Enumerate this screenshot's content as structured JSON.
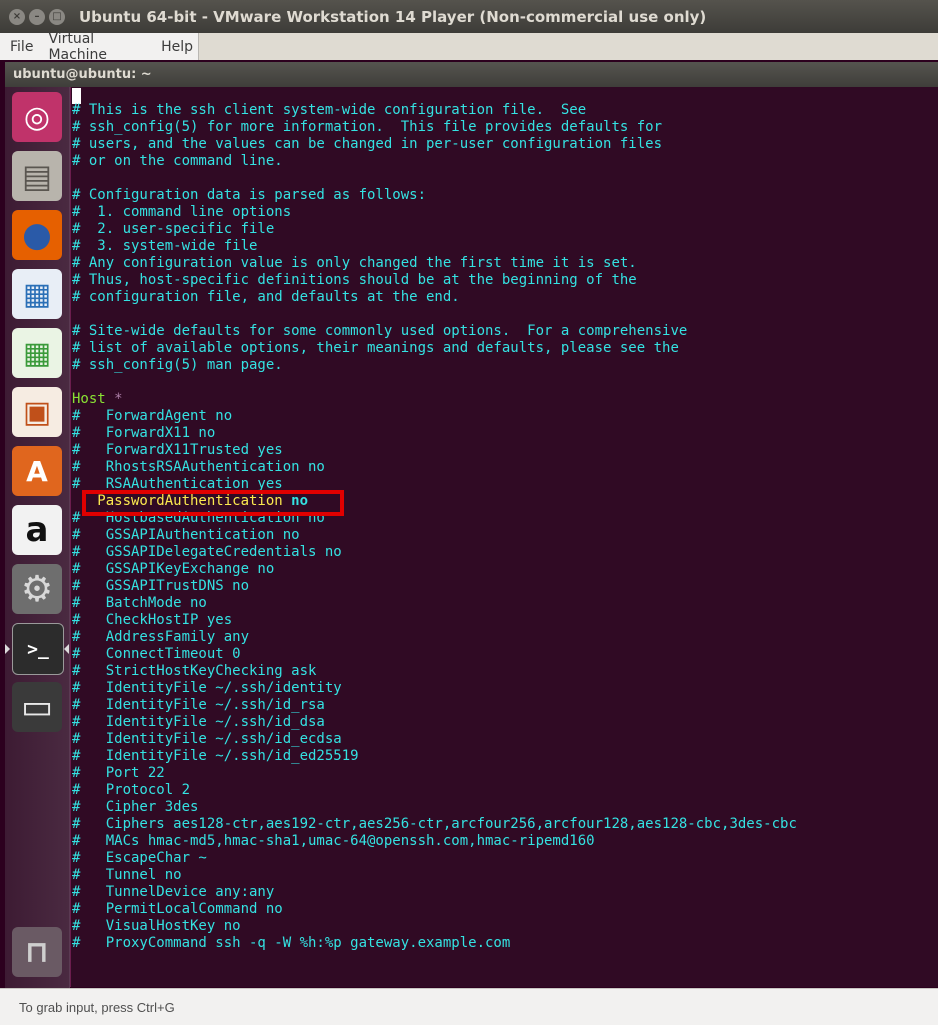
{
  "window": {
    "title": "Ubuntu 64-bit - VMware Workstation 14 Player (Non-commercial use only)",
    "close_glyph": "×",
    "min_glyph": "–",
    "max_glyph": "□"
  },
  "menu": {
    "items": [
      "File",
      "Virtual Machine",
      "Help"
    ]
  },
  "terminal": {
    "title": "ubuntu@ubuntu: ~",
    "lines": [
      "# This is the ssh client system-wide configuration file.  See",
      "# ssh_config(5) for more information.  This file provides defaults for",
      "# users, and the values can be changed in per-user configuration files",
      "# or on the command line.",
      "",
      "# Configuration data is parsed as follows:",
      "#  1. command line options",
      "#  2. user-specific file",
      "#  3. system-wide file",
      "# Any configuration value is only changed the first time it is set.",
      "# Thus, host-specific definitions should be at the beginning of the",
      "# configuration file, and defaults at the end.",
      "",
      "# Site-wide defaults for some commonly used options.  For a comprehensive",
      "# list of available options, their meanings and defaults, please see the",
      "# ssh_config(5) man page.",
      ""
    ],
    "host_keyword": "Host",
    "host_star": " *",
    "host_lines": [
      "#   ForwardAgent no",
      "#   ForwardX11 no",
      "#   ForwardX11Trusted yes",
      "#   RhostsRSAAuthentication no",
      "#   RSAAuthentication yes"
    ],
    "highlight_key": "   PasswordAuthentication ",
    "highlight_value": "no",
    "rest_lines": [
      "#   HostbasedAuthentication no",
      "#   GSSAPIAuthentication no",
      "#   GSSAPIDelegateCredentials no",
      "#   GSSAPIKeyExchange no",
      "#   GSSAPITrustDNS no",
      "#   BatchMode no",
      "#   CheckHostIP yes",
      "#   AddressFamily any",
      "#   ConnectTimeout 0",
      "#   StrictHostKeyChecking ask",
      "#   IdentityFile ~/.ssh/identity",
      "#   IdentityFile ~/.ssh/id_rsa",
      "#   IdentityFile ~/.ssh/id_dsa",
      "#   IdentityFile ~/.ssh/id_ecdsa",
      "#   IdentityFile ~/.ssh/id_ed25519",
      "#   Port 22",
      "#   Protocol 2",
      "#   Cipher 3des",
      "#   Ciphers aes128-ctr,aes192-ctr,aes256-ctr,arcfour256,arcfour128,aes128-cbc,3des-cbc",
      "#   MACs hmac-md5,hmac-sha1,umac-64@openssh.com,hmac-ripemd160",
      "#   EscapeChar ~",
      "#   Tunnel no",
      "#   TunnelDevice any:any",
      "#   PermitLocalCommand no",
      "#   VisualHostKey no",
      "#   ProxyCommand ssh -q -W %h:%p gateway.example.com"
    ]
  },
  "launcher": {
    "icons": [
      {
        "name": "ubuntu-dash-icon",
        "glyph": "◎",
        "bg": "#c0336a",
        "fg": "#ffffff"
      },
      {
        "name": "files-icon",
        "glyph": "▤",
        "bg": "#b8b4ac",
        "fg": "#5a5650"
      },
      {
        "name": "firefox-icon",
        "glyph": "●",
        "bg": "#e66000",
        "fg": "#2a5aa8"
      },
      {
        "name": "writer-icon",
        "glyph": "▦",
        "bg": "#e8eef6",
        "fg": "#2a6fb6"
      },
      {
        "name": "calc-icon",
        "glyph": "▦",
        "bg": "#eaf4e4",
        "fg": "#3a9a3a"
      },
      {
        "name": "impress-icon",
        "glyph": "▣",
        "bg": "#f6ece2",
        "fg": "#c0501a"
      },
      {
        "name": "software-center-icon",
        "glyph": "A",
        "bg": "#e0661e",
        "fg": "#ffffff"
      },
      {
        "name": "amazon-icon",
        "glyph": "a",
        "bg": "#f2f2f2",
        "fg": "#111111"
      },
      {
        "name": "system-settings-icon",
        "glyph": "⚙",
        "bg": "#6e6e6e",
        "fg": "#d8d8d8"
      },
      {
        "name": "terminal-icon",
        "glyph": ">_",
        "bg": "#2c2c2c",
        "fg": "#ffffff"
      },
      {
        "name": "save-disk-icon",
        "glyph": "▭",
        "bg": "#3a3a3a",
        "fg": "#e8e8e8"
      },
      {
        "name": "trash-icon",
        "glyph": "⊓",
        "bg": "#6a5a64",
        "fg": "#cfcfcf"
      }
    ]
  },
  "status": {
    "text": "To grab input, press Ctrl+G"
  }
}
